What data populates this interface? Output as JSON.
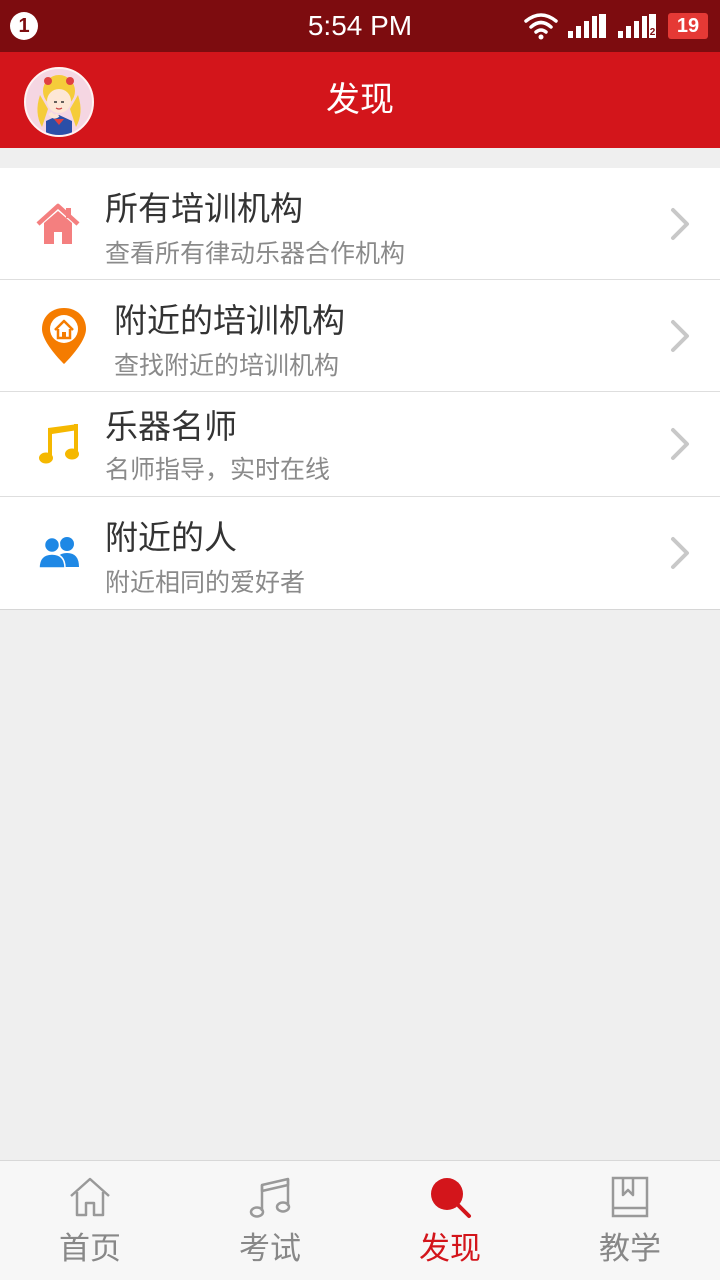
{
  "status_bar": {
    "notification_count": "1",
    "time": "5:54 PM",
    "sim2_label": "2",
    "battery": "19"
  },
  "header": {
    "title": "发现"
  },
  "items": [
    {
      "title": "所有培训机构",
      "subtitle": "查看所有律动乐器合作机构",
      "icon": "house-icon"
    },
    {
      "title": "附近的培训机构",
      "subtitle": "查找附近的培训机构",
      "icon": "location-pin-icon"
    },
    {
      "title": "乐器名师",
      "subtitle": "名师指导，实时在线",
      "icon": "music-note-icon"
    },
    {
      "title": "附近的人",
      "subtitle": "附近相同的爱好者",
      "icon": "people-icon"
    }
  ],
  "bottom_nav": {
    "tabs": [
      {
        "label": "首页",
        "icon": "home-icon",
        "active": false
      },
      {
        "label": "考试",
        "icon": "music-note-icon",
        "active": false
      },
      {
        "label": "发现",
        "icon": "search-icon",
        "active": true
      },
      {
        "label": "教学",
        "icon": "book-icon",
        "active": false
      }
    ]
  },
  "colors": {
    "status_bar": "#7d0c0f",
    "header": "#d3151b",
    "active_tab": "#d3151b",
    "house_icon": "#f47f7f",
    "pin_icon": "#f57c00",
    "note_icon": "#f5b800",
    "people_icon": "#1e88e5"
  }
}
